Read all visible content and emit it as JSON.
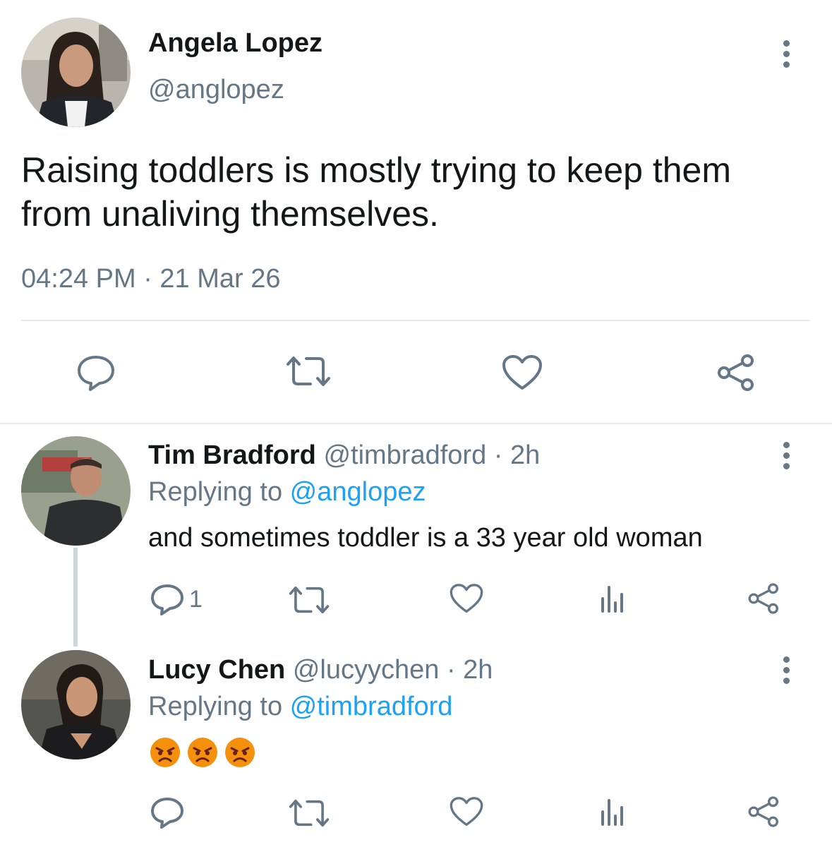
{
  "main_tweet": {
    "author_name": "Angela Lopez",
    "author_handle": "@anglopez",
    "text_line1": "Raising toddlers is mostly trying to keep them",
    "text_line2": "from unaliving themselves.",
    "timestamp": "04:24 PM · 21 Mar 26",
    "actions": [
      "reply-icon",
      "retweet-icon",
      "like-icon",
      "share-icon"
    ]
  },
  "replies": [
    {
      "author_name": "Tim Bradford",
      "author_handle": "@timbradford",
      "time": "· 2h",
      "replying_prefix": "Replying to ",
      "replying_to": "@anglopez",
      "text": "and sometimes toddler is a 33 year old woman",
      "reply_count": "1",
      "actions": [
        "reply-icon",
        "retweet-icon",
        "like-icon",
        "analytics-icon",
        "share-icon"
      ]
    },
    {
      "author_name": "Lucy Chen",
      "author_handle": "@lucyychen",
      "time": "· 2h",
      "replying_prefix": "Replying to ",
      "replying_to": "@timbradford",
      "text_emoji": [
        "angry-face-emoji",
        "angry-face-emoji",
        "angry-face-emoji"
      ],
      "actions": [
        "reply-icon",
        "retweet-icon",
        "like-icon",
        "analytics-icon",
        "share-icon"
      ]
    }
  ],
  "colors": {
    "text": "#14171a",
    "muted": "#657786",
    "link": "#1da1f2",
    "divider": "#e6ecf0",
    "emoji": "#f4900c"
  }
}
